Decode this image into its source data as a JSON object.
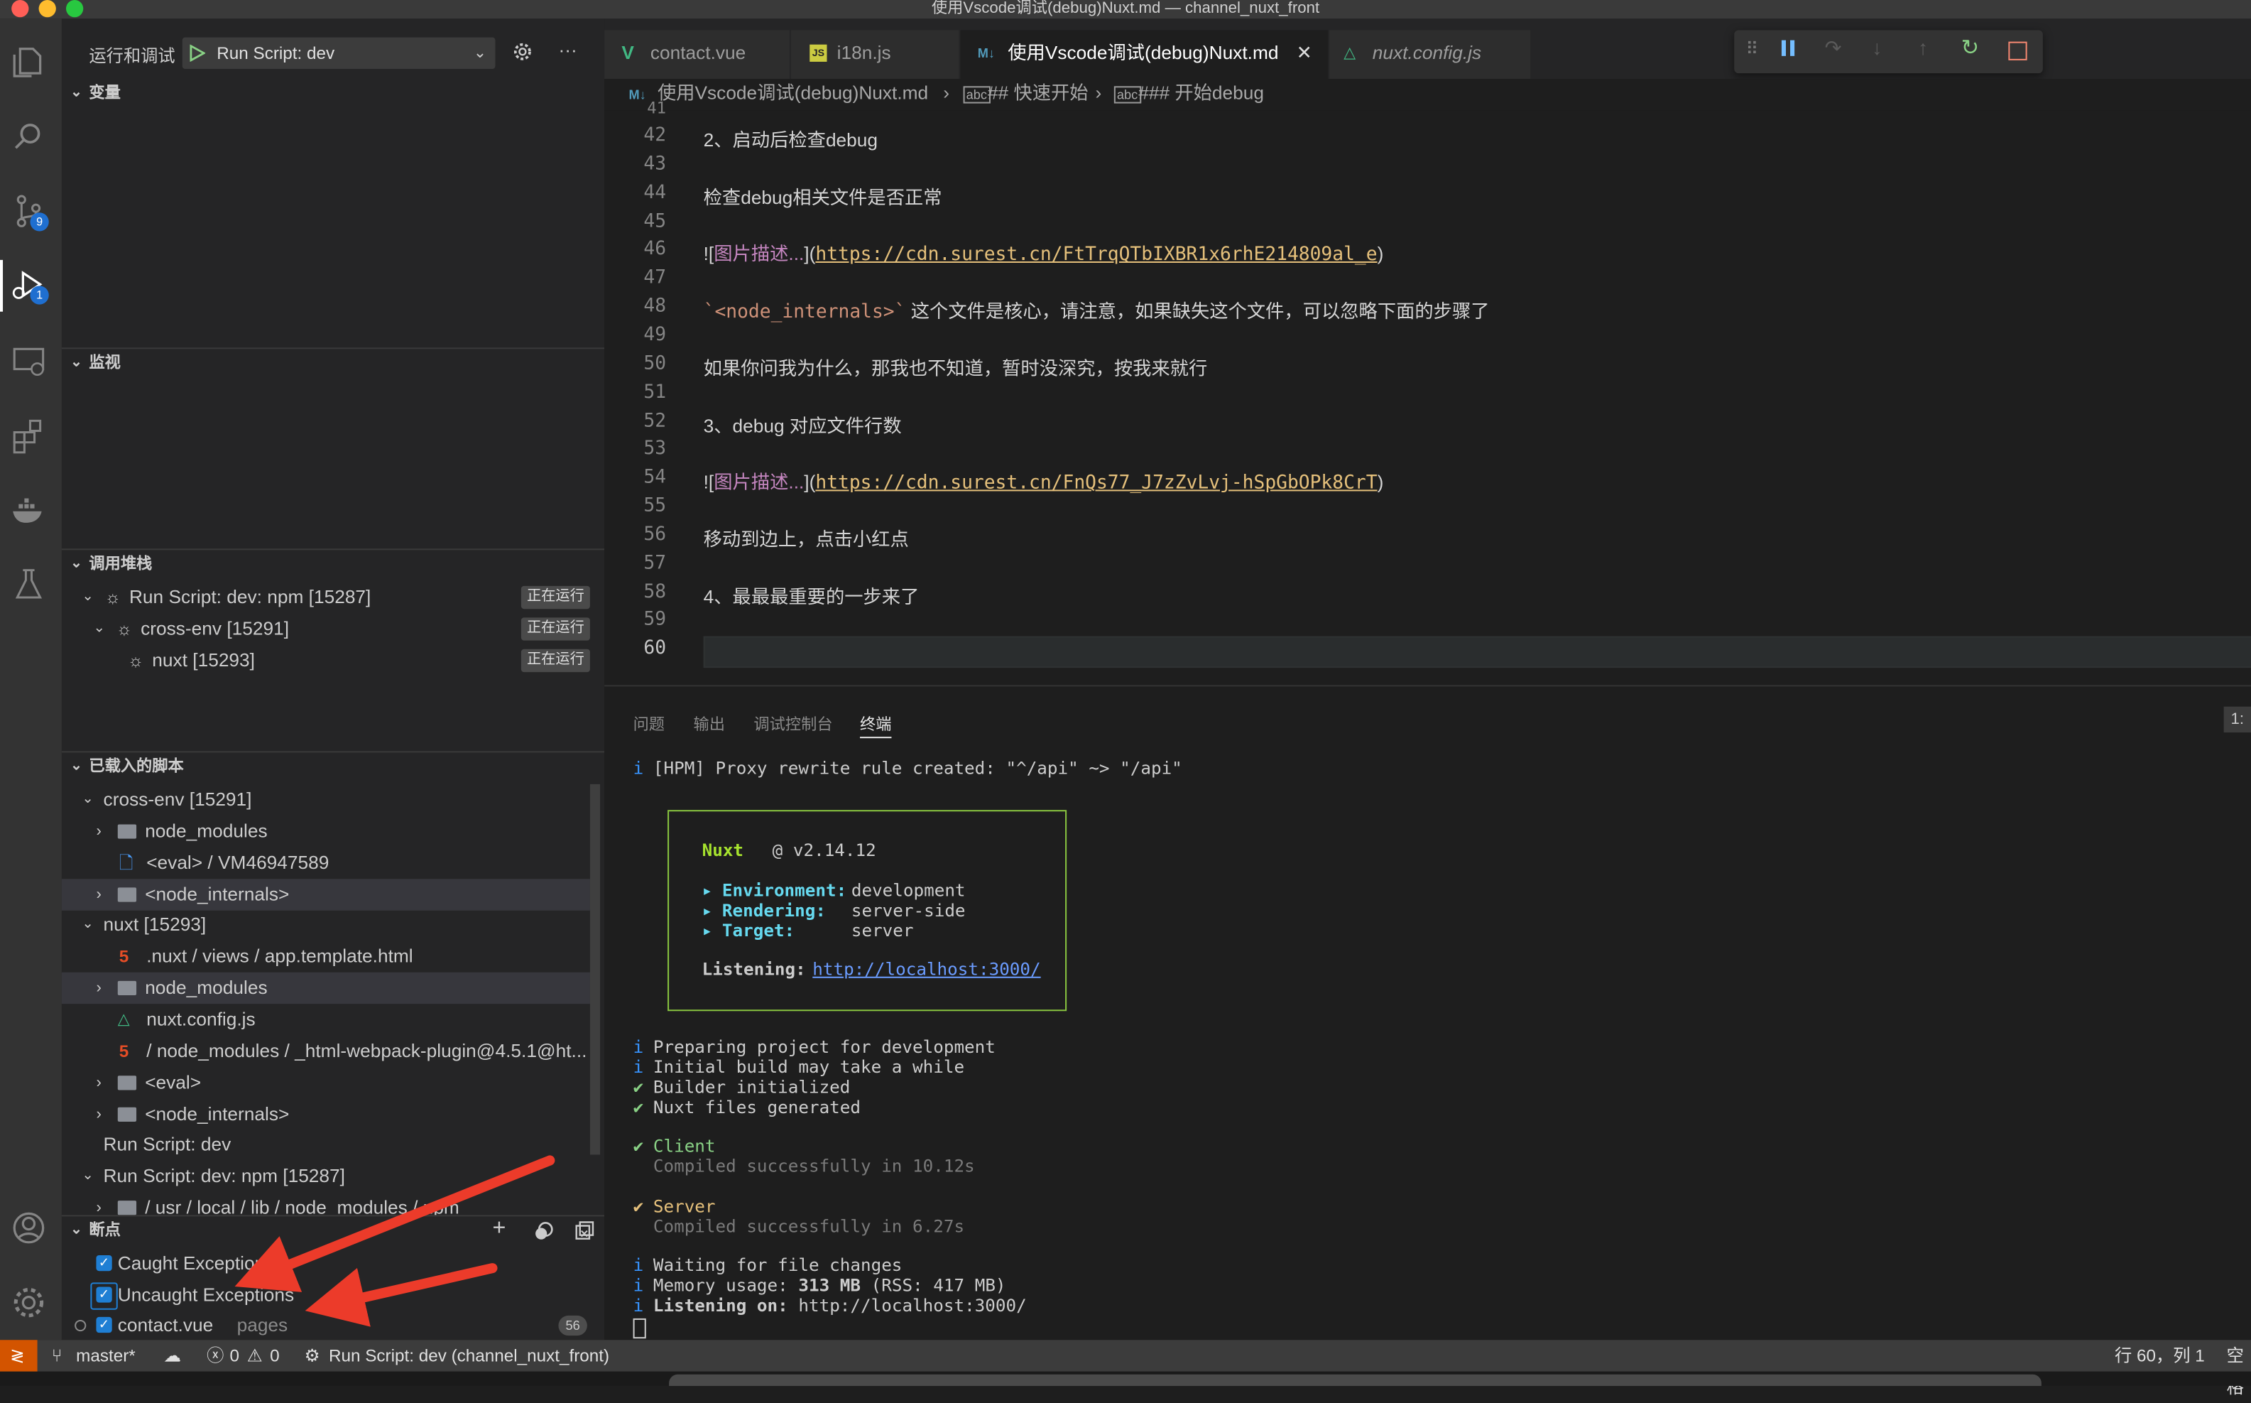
{
  "window": {
    "title": "使用Vscode调试(debug)Nuxt.md — channel_nuxt_front"
  },
  "activity_bar": {
    "source_control_badge": "9",
    "debug_badge": "1"
  },
  "run_debug": {
    "title": "运行和调试",
    "config_label": "Run Script: dev"
  },
  "sections": {
    "variables": "变量",
    "watch": "监视",
    "call_stack": "调用堆栈",
    "loaded_scripts": "已载入的脚本",
    "breakpoints": "断点"
  },
  "call_stack": [
    {
      "label": "Run Script: dev: npm [15287]",
      "status": "正在运行"
    },
    {
      "label": "cross-env [15291]",
      "status": "正在运行"
    },
    {
      "label": "nuxt [15293]",
      "status": "正在运行"
    }
  ],
  "loaded_scripts": [
    {
      "label": "cross-env [15291]"
    },
    {
      "label": "node_modules"
    },
    {
      "label": "<eval> / VM46947589"
    },
    {
      "label": "<node_internals>"
    },
    {
      "label": "nuxt [15293]"
    },
    {
      "label": ".nuxt / views / app.template.html"
    },
    {
      "label": "node_modules"
    },
    {
      "label": "nuxt.config.js"
    },
    {
      "label": "/ node_modules / _html-webpack-plugin@4.5.1@ht..."
    },
    {
      "label": "<eval>"
    },
    {
      "label": "<node_internals>"
    },
    {
      "label": "Run Script: dev"
    },
    {
      "label": "Run Script: dev: npm [15287]"
    },
    {
      "label": "/ usr / local / lib / node_modules / npm"
    }
  ],
  "breakpoints": [
    {
      "label": "Caught Exceptions"
    },
    {
      "label": "Uncaught Exceptions"
    },
    {
      "label": "contact.vue",
      "path": "pages",
      "line": "56"
    }
  ],
  "tabs": [
    {
      "label": "contact.vue"
    },
    {
      "label": "i18n.js"
    },
    {
      "label": "使用Vscode调试(debug)Nuxt.md"
    },
    {
      "label": "nuxt.config.js"
    }
  ],
  "breadcrumb": {
    "file": "使用Vscode调试(debug)Nuxt.md",
    "h2": "## 快速开始",
    "h3": "### 开始debug"
  },
  "editor_lines": [
    {
      "n": "42",
      "text": "2、启动后检查debug"
    },
    {
      "n": "43",
      "text": ""
    },
    {
      "n": "44",
      "text": "检查debug相关文件是否正常"
    },
    {
      "n": "45",
      "text": ""
    },
    {
      "n": "46",
      "img": "![",
      "alt": "图片描述...",
      "mid": "](",
      "url": "https://cdn.surest.cn/FtTrqQTbIXBR1x6rhE214809al_e",
      "end": ")"
    },
    {
      "n": "47",
      "text": ""
    },
    {
      "n": "48",
      "codespan": "`<node_internals>`",
      "text": " 这个文件是核心，请注意，如果缺失这个文件，可以忽略下面的步骤了"
    },
    {
      "n": "49",
      "text": ""
    },
    {
      "n": "50",
      "text": "如果你问我为什么，那我也不知道，暂时没深究，按我来就行"
    },
    {
      "n": "51",
      "text": ""
    },
    {
      "n": "52",
      "text": "3、debug 对应文件行数"
    },
    {
      "n": "53",
      "text": ""
    },
    {
      "n": "54",
      "img": "![",
      "alt": "图片描述...",
      "mid": "](",
      "url": "https://cdn.surest.cn/FnQs77_J7zZvLvj-hSpGbOPk8CrT",
      "end": ")"
    },
    {
      "n": "55",
      "text": ""
    },
    {
      "n": "56",
      "text": "移动到边上，点击小红点"
    },
    {
      "n": "57",
      "text": ""
    },
    {
      "n": "58",
      "text": "4、最最最重要的一步来了"
    },
    {
      "n": "59",
      "text": ""
    },
    {
      "n": "60",
      "text": ""
    }
  ],
  "panel_tabs": [
    "问题",
    "输出",
    "调试控制台",
    "终端"
  ],
  "terminal": {
    "proxy": "[HPM] Proxy rewrite rule created: \"^/api\" ~> \"/api\"",
    "nuxt": "Nuxt",
    "version": "@ v2.14.12",
    "env_key": "Environment:",
    "env_val": "development",
    "render_key": "Rendering:",
    "render_val": "server-side",
    "target_key": "Target:",
    "target_val": "server",
    "listen_key": "Listening:",
    "listen_val": "http://localhost:3000/",
    "prep1": "Preparing project for development",
    "prep2": "Initial build may take a while",
    "prep3": "Builder initialized",
    "prep4": "Nuxt files generated",
    "client": "Client",
    "client_msg": "Compiled successfully in 10.12s",
    "server": "Server",
    "server_msg": "Compiled successfully in 6.27s",
    "wait": "Waiting for file changes",
    "mem_a": "Memory usage: ",
    "mem_b": "313 MB",
    "mem_c": " (RSS: 417 MB)",
    "listen2_key": "Listening on:",
    "listen2_val": "http://localhost:3000/"
  },
  "status_bar": {
    "branch": "master*",
    "errors": "0",
    "warnings": "0",
    "run": "Run Script: dev (channel_nuxt_front)",
    "position": "行 60，列 1",
    "indent": "空格"
  },
  "panel_right_badge": "1:"
}
